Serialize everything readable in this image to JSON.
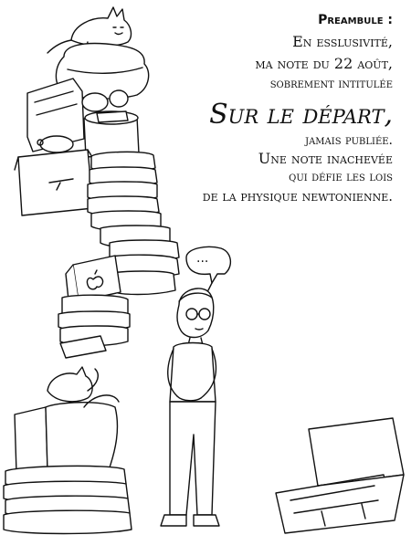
{
  "text": {
    "preamble": "Preambule :",
    "line1": "En esslusivité,",
    "line2": "ma note du 22 août,",
    "line3": "sobrement intitulée",
    "title": "Sur le départ,",
    "line4": "jamais publiée.",
    "line5": "Une note inachevée",
    "line6": "qui défie les lois",
    "line7": "de la physique newtonienne."
  },
  "speech_bubble": {
    "text": "..."
  },
  "icons": [
    "cat-icon",
    "apple-logo-icon",
    "glasses-icon",
    "suitcase-icon"
  ]
}
